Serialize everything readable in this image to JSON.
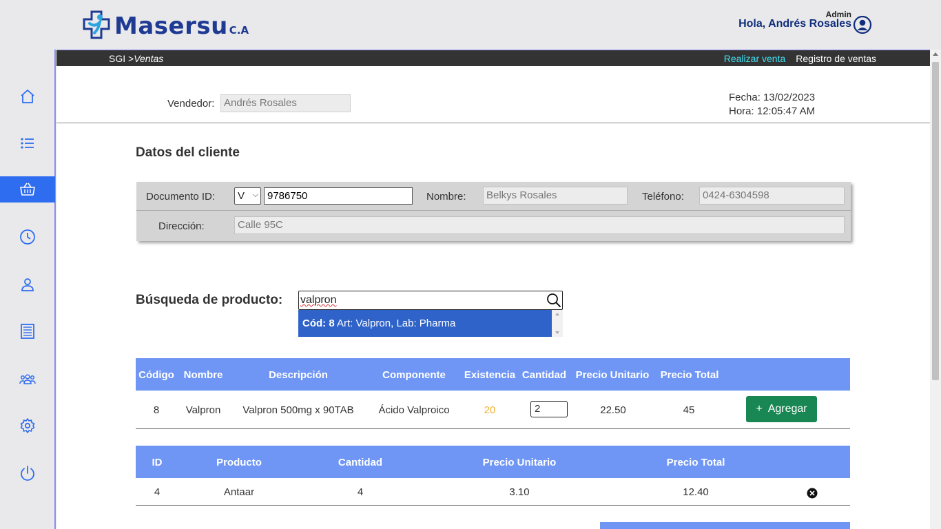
{
  "brand": {
    "name": "Masersu",
    "suffix": "C.A"
  },
  "user": {
    "role": "Admin",
    "greeting": "Hola, Andrés Rosales"
  },
  "sidebar": {
    "items": [
      {
        "icon": "home-icon"
      },
      {
        "icon": "list-icon"
      },
      {
        "icon": "basket-icon",
        "active": true
      },
      {
        "icon": "clock-icon"
      },
      {
        "icon": "user-icon"
      },
      {
        "icon": "receipt-icon"
      },
      {
        "icon": "group-icon"
      },
      {
        "icon": "gear-icon"
      },
      {
        "icon": "power-icon"
      }
    ]
  },
  "topbar": {
    "crumb_root": "SGI >",
    "crumb_current": "Ventas",
    "nav": [
      "Realizar venta",
      "Registro de ventas"
    ]
  },
  "sale": {
    "vendedor_label": "Vendedor:",
    "vendedor_value": "Andrés Rosales",
    "fecha": "Fecha: 13/02/2023",
    "hora": "Hora: 12:05:47 AM"
  },
  "client": {
    "title": "Datos del cliente",
    "doc_label": "Documento ID:",
    "doc_type": "V",
    "doc_number": "9786750",
    "name_label": "Nombre:",
    "name_value": "Belkys Rosales",
    "phone_label": "Teléfono:",
    "phone_value": "0424-6304598",
    "address_label": "Dirección:",
    "address_value": "Calle 95C"
  },
  "search": {
    "label": "Búsqueda de producto:",
    "value": "valpron",
    "suggestion_code": "Cód: 8",
    "suggestion_text": " Art: Valpron, Lab: Pharma"
  },
  "product_table": {
    "headers": [
      "Código",
      "Nombre",
      "Descripción",
      "Componente",
      "Existencia",
      "Cantidad",
      "Precio Unitario",
      "Precio Total"
    ],
    "row": {
      "code": "8",
      "name": "Valpron",
      "description": "Valpron 500mg x 90TAB",
      "component": "Ácido Valproico",
      "stock": "20",
      "quantity": "2",
      "unit_price": "22.50",
      "total": "45"
    },
    "add_label": "Agregar"
  },
  "cart_table": {
    "headers": [
      "ID",
      "Producto",
      "Cantidad",
      "Precio Unitario",
      "Precio Total"
    ],
    "rows": [
      {
        "id": "4",
        "product": "Antaar",
        "qty": "4",
        "unit": "3.10",
        "total": "12.40"
      }
    ]
  },
  "colors": {
    "brand": "#1f3a93",
    "accent": "#6f96f5",
    "active_nav": "#2f6df0",
    "add_button": "#198754",
    "stock": "#f0b030"
  }
}
